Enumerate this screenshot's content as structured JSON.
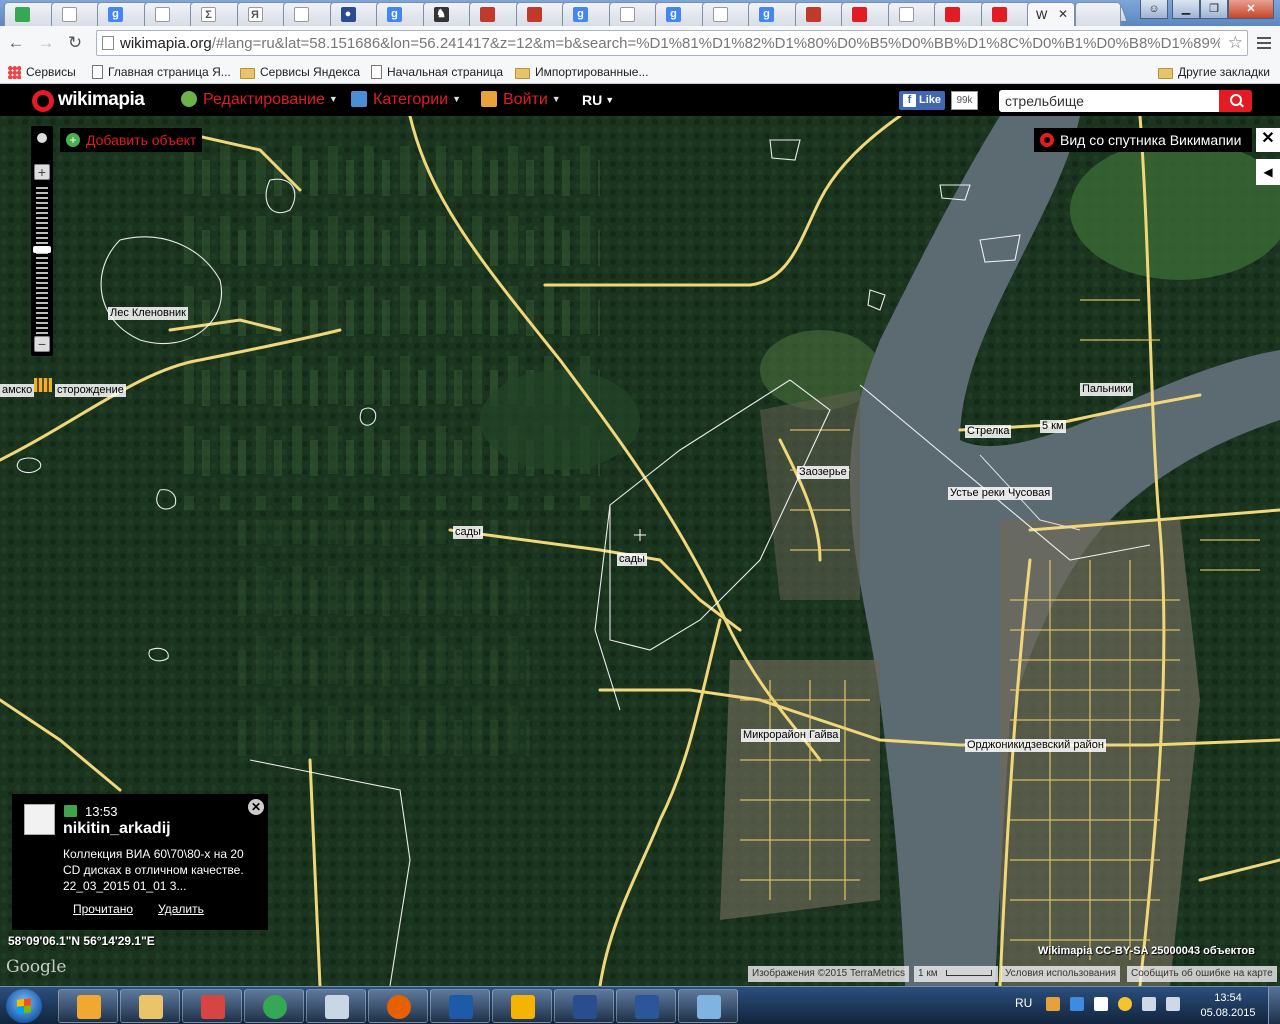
{
  "browser": {
    "url_host": "wikimapia.org",
    "url_rest": "/#lang=ru&lat=58.151686&lon=56.241417&z=12&m=b&search=%D1%81%D1%82%D1%80%D0%B5%D0%BB%D1%8C%D0%B1%D0%B8%D1%89%D0%B5",
    "active_tab_title": "W",
    "tab_icons": [
      "chrome-icon",
      "page-icon",
      "google-icon",
      "page-icon",
      "sigma-icon",
      "yandex-icon",
      "page-icon",
      "user-icon",
      "google-icon",
      "chess-icon",
      "emblem-icon",
      "emblem-icon",
      "google-icon",
      "page-icon",
      "google-icon",
      "page-icon",
      "google-icon",
      "emblem-icon",
      "target-icon",
      "page-icon",
      "wikimapia-icon",
      "maps-pin-icon"
    ],
    "bookmarks": [
      {
        "label": "Сервисы",
        "icon": "apps-icon"
      },
      {
        "label": "Главная страница Я...",
        "icon": "doc-icon"
      },
      {
        "label": "Сервисы Яндекса",
        "icon": "folder-icon"
      },
      {
        "label": "Начальная страница",
        "icon": "doc-icon"
      },
      {
        "label": "Импортированные...",
        "icon": "folder-icon"
      }
    ],
    "other_bookmarks": "Другие закладки"
  },
  "header": {
    "logo": "wikimapia",
    "menu": [
      {
        "label": "Редактирование",
        "icon": "globe-edit-icon",
        "icon_color": "#6bb34a"
      },
      {
        "label": "Категории",
        "icon": "categories-icon",
        "icon_color": "#4a8fd6"
      },
      {
        "label": "Войти",
        "icon": "login-icon",
        "icon_color": "#e8a33a"
      }
    ],
    "language": "RU",
    "fb_like": "Like",
    "fb_count": "99k",
    "search_value": "стрельбище",
    "accent_color": "#e31b23"
  },
  "map": {
    "add_object": "Добавить объект",
    "satellite_panel": "Вид со спутника Викимапии",
    "labels": [
      {
        "id": "les-klenovnik",
        "text": "Лес Кленовник"
      },
      {
        "id": "mesto",
        "text": "амско"
      },
      {
        "id": "mestorozhdenie",
        "text": "сторождение"
      },
      {
        "id": "sady-1",
        "text": "сады"
      },
      {
        "id": "sady-2",
        "text": "сады"
      },
      {
        "id": "zaozerye",
        "text": "Заозерье"
      },
      {
        "id": "strelka",
        "text": "Стрелка"
      },
      {
        "id": "5km",
        "text": "5 км"
      },
      {
        "id": "palniki",
        "text": "Пальники"
      },
      {
        "id": "ustye",
        "text": "Устье реки Чусовая"
      },
      {
        "id": "gayva",
        "text": "Микрорайон Гайва"
      },
      {
        "id": "ordzh",
        "text": "Орджоникидзевский район"
      }
    ],
    "coordinates": "58°09'06.1\"N 56°14'29.1\"E",
    "google": "Google",
    "stats": "Wikimapia CC-BY-SA  25000043 объектов",
    "attribution": "Изображения ©2015 TerraMetrics",
    "scale": "1 км",
    "terms": "Условия использования",
    "report": "Сообщить об ошибке на карте"
  },
  "notification": {
    "time": "13:53",
    "user": "nikitin_arkadij",
    "message": "Коллекция ВИА 60\\70\\80-х на 20 CD дисках в отличном качестве. 22_03_2015 01_01 3...",
    "read_link": "Прочитано",
    "delete_link": "Удалить"
  },
  "taskbar": {
    "apps": [
      "help-icon",
      "explorer-icon",
      "photo-icon",
      "chrome-icon",
      "calculator-icon",
      "firefox-icon",
      "mail-icon",
      "office-icon",
      "save-icon",
      "word-icon",
      "paint-icon"
    ],
    "language": "RU",
    "time": "13:54",
    "date": "05.08.2015"
  }
}
